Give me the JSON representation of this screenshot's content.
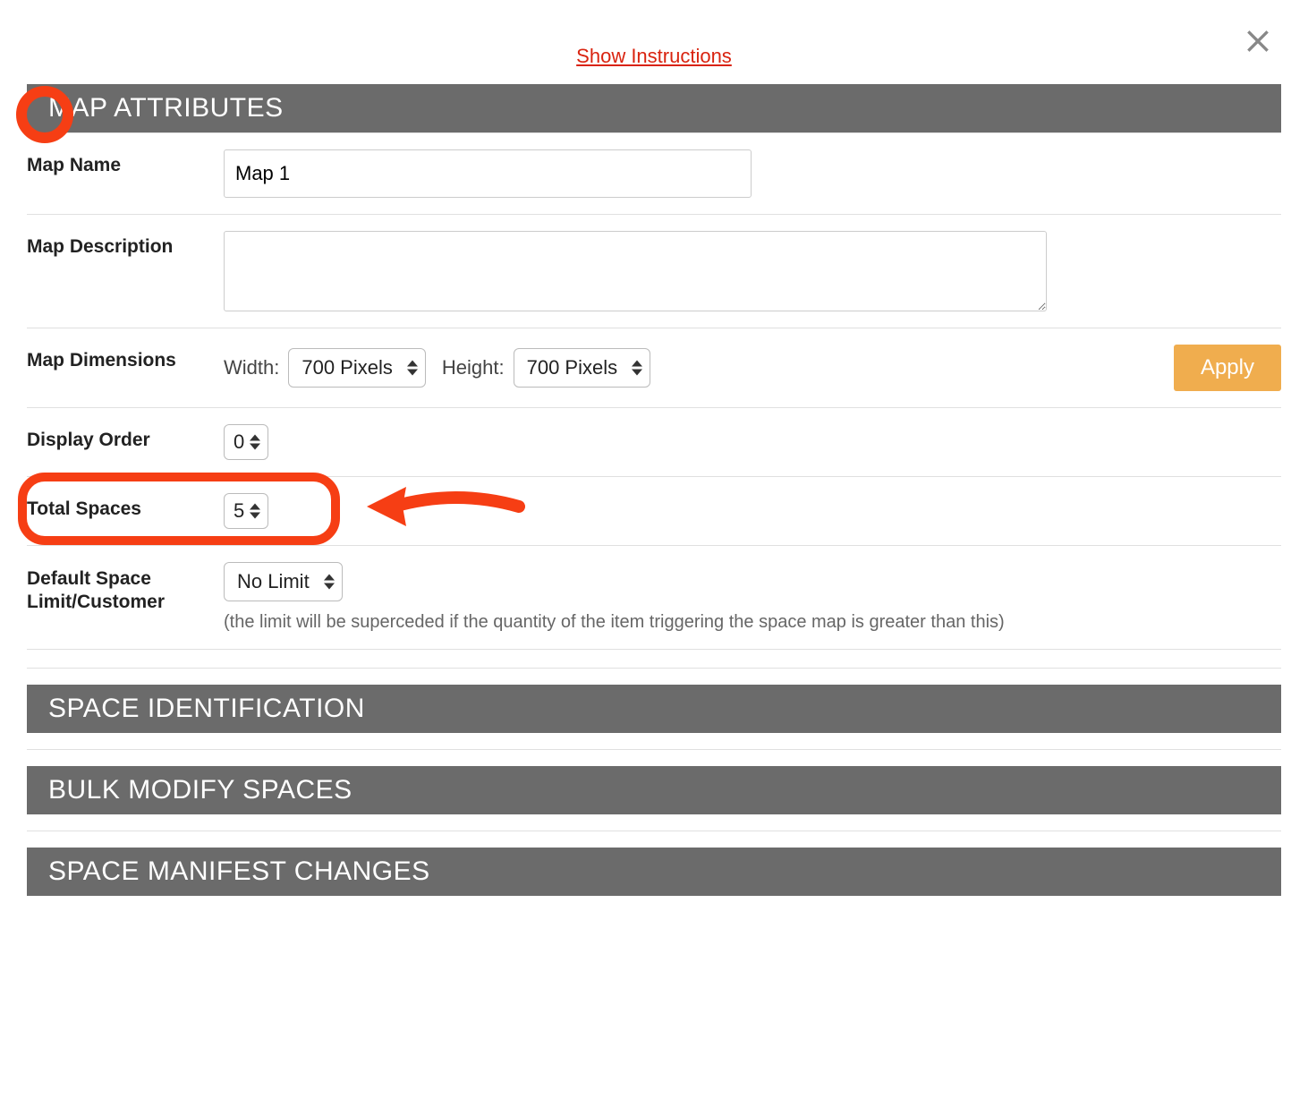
{
  "top_link": "Show Instructions",
  "sections": {
    "map_attributes": "MAP ATTRIBUTES",
    "space_identification": "SPACE IDENTIFICATION",
    "bulk_modify": "BULK MODIFY SPACES",
    "manifest_changes": "SPACE MANIFEST CHANGES"
  },
  "labels": {
    "map_name": "Map Name",
    "map_description": "Map Description",
    "map_dimensions": "Map Dimensions",
    "width": "Width:",
    "height": "Height:",
    "display_order": "Display Order",
    "total_spaces": "Total Spaces",
    "default_space_limit": "Default Space Limit/Customer"
  },
  "values": {
    "map_name": "Map 1",
    "map_description": "",
    "width_select": "700 Pixels",
    "height_select": "700 Pixels",
    "display_order": "0",
    "total_spaces": "5",
    "default_space_limit": "No Limit"
  },
  "buttons": {
    "apply": "Apply"
  },
  "hints": {
    "default_limit": "(the limit will be superceded if the quantity of the item triggering the space map is greater than this)"
  }
}
